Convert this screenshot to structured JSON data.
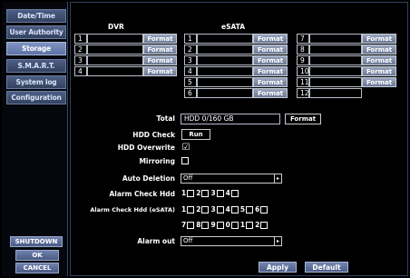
{
  "sidebar": {
    "tabs": [
      {
        "label": "Date/Time"
      },
      {
        "label": "User Authority"
      },
      {
        "label": "Storage"
      },
      {
        "label": "S.M.A.R.T."
      },
      {
        "label": "System log"
      },
      {
        "label": "Configuration"
      }
    ],
    "shutdown_label": "SHUTDOWN",
    "ok_label": "OK",
    "cancel_label": "CANCEL"
  },
  "storage": {
    "dvr_header": "DVR",
    "esata_header": "eSATA",
    "format_label": "Format",
    "dvr_rows": [
      "1",
      "2",
      "3",
      "4"
    ],
    "esata_col1": [
      "1",
      "2",
      "3",
      "4",
      "5",
      "6"
    ],
    "esata_col2": [
      "7",
      "8",
      "9",
      "10",
      "11",
      "12"
    ],
    "total_label": "Total",
    "total_value": "HDD 0/160 GB",
    "total_format_label": "Format",
    "hdd_check_label": "HDD Check",
    "run_label": "Run",
    "hdd_overwrite_label": "HDD Overwrite",
    "hdd_overwrite_checked": "☑",
    "mirroring_label": "Mirroring",
    "auto_deletion_label": "Auto Deletion",
    "auto_deletion_value": "Off",
    "alarm_check_hdd_label": "Alarm Check Hdd",
    "alarm_check_hdd_items": [
      "1",
      "2",
      "3",
      "4"
    ],
    "alarm_check_esata_label": "Alarm Check Hdd (eSATA)",
    "alarm_check_esata_row1": [
      "1",
      "2",
      "3",
      "4",
      "5",
      "6"
    ],
    "alarm_check_esata_row2": [
      "7",
      "8",
      "9",
      "0",
      "1",
      "2"
    ],
    "alarm_out_label": "Alarm out",
    "alarm_out_value": "Off",
    "apply_label": "Apply",
    "default_label": "Default"
  }
}
